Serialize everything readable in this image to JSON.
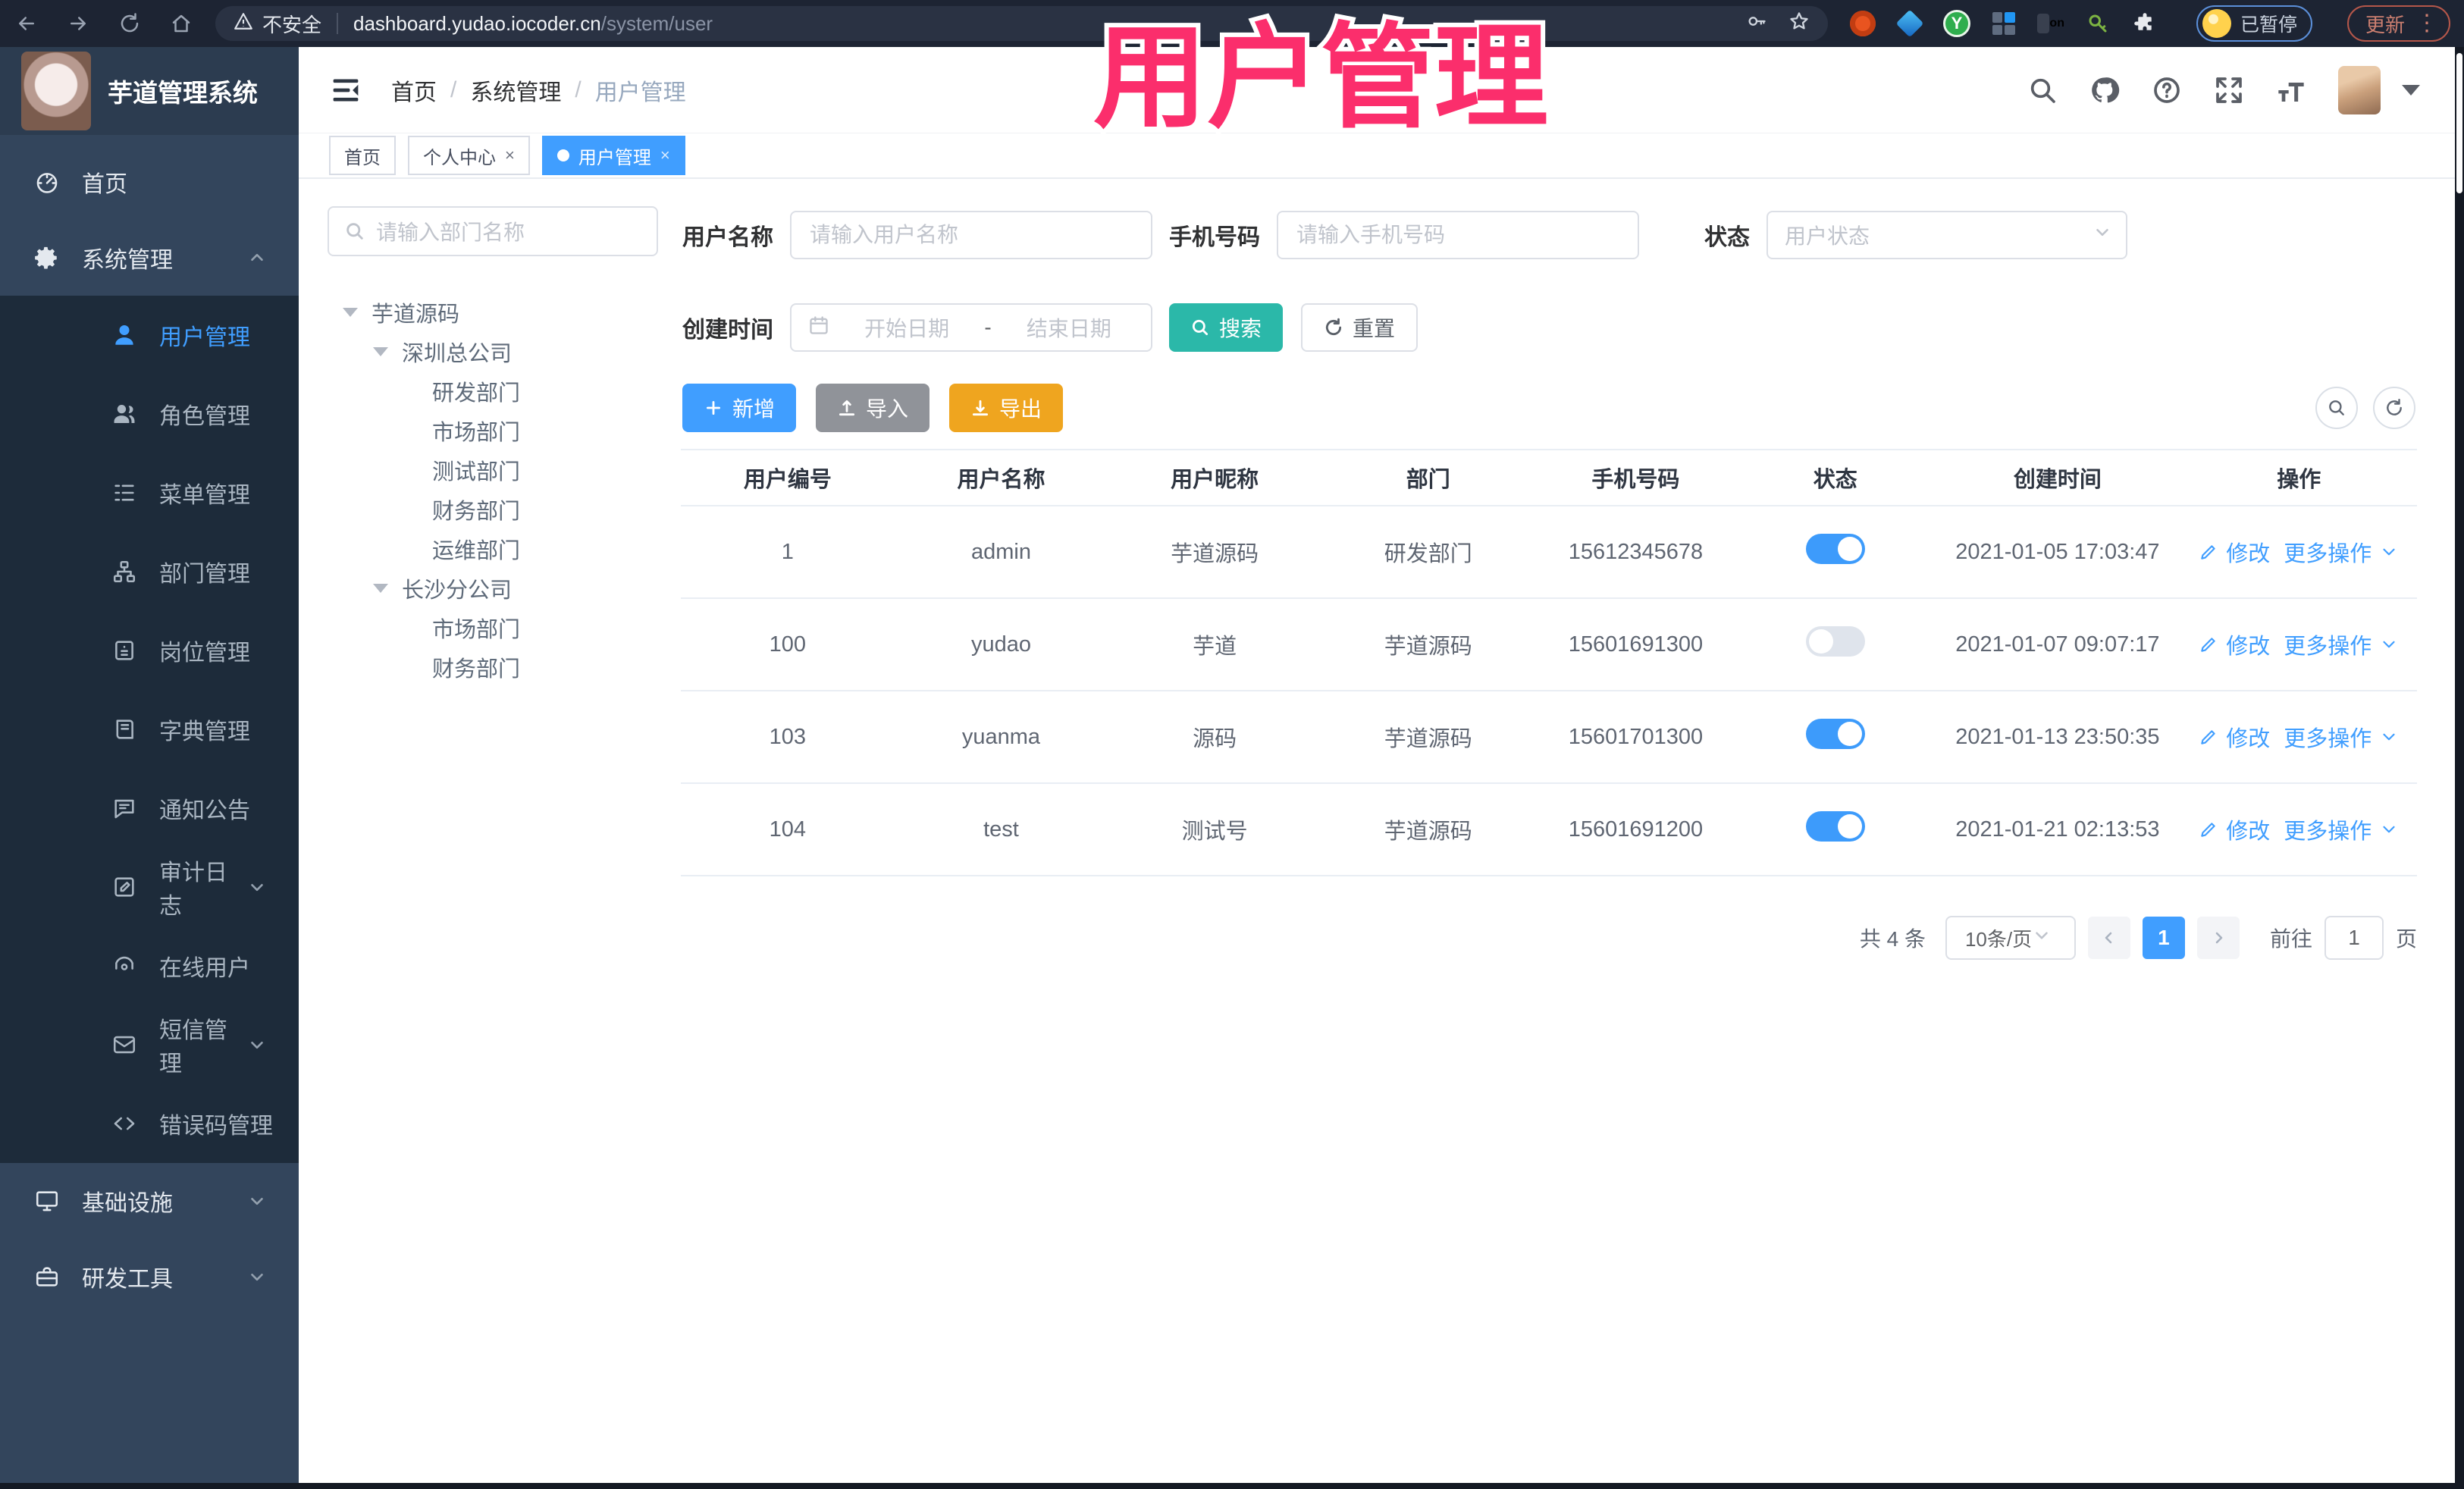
{
  "browser": {
    "url_warning": "不安全",
    "url_host": "dashboard.yudao.iocoder.cn",
    "url_path": "/system/user",
    "paused_badge": "已暂停",
    "update_button": "更新",
    "ext_on_badge": "on",
    "ext_y_letter": "Y"
  },
  "app": {
    "title": "芋道管理系统",
    "overlay_title": "用户管理"
  },
  "breadcrumb": {
    "items": [
      "首页",
      "系统管理",
      "用户管理"
    ]
  },
  "tabs": [
    {
      "label": "首页",
      "closable": false,
      "active": false
    },
    {
      "label": "个人中心",
      "closable": true,
      "active": false
    },
    {
      "label": "用户管理",
      "closable": true,
      "active": true
    }
  ],
  "sidebar": {
    "items": [
      {
        "label": "首页",
        "icon": "dashboard-icon",
        "level": 0
      },
      {
        "label": "系统管理",
        "icon": "gear-icon",
        "level": 0,
        "chevron": "up"
      },
      {
        "label": "用户管理",
        "icon": "user-icon",
        "level": 1,
        "active": true
      },
      {
        "label": "角色管理",
        "icon": "roles-icon",
        "level": 1
      },
      {
        "label": "菜单管理",
        "icon": "menu-tree-icon",
        "level": 1
      },
      {
        "label": "部门管理",
        "icon": "org-icon",
        "level": 1
      },
      {
        "label": "岗位管理",
        "icon": "post-icon",
        "level": 1
      },
      {
        "label": "字典管理",
        "icon": "dict-icon",
        "level": 1
      },
      {
        "label": "通知公告",
        "icon": "notice-icon",
        "level": 1
      },
      {
        "label": "审计日志",
        "icon": "log-icon",
        "level": 1,
        "chevron": "down"
      },
      {
        "label": "在线用户",
        "icon": "online-icon",
        "level": 1
      },
      {
        "label": "短信管理",
        "icon": "sms-icon",
        "level": 1,
        "chevron": "down"
      },
      {
        "label": "错误码管理",
        "icon": "code-icon",
        "level": 1
      },
      {
        "label": "基础设施",
        "icon": "infra-icon",
        "level": 0,
        "chevron": "down"
      },
      {
        "label": "研发工具",
        "icon": "tools-icon",
        "level": 0,
        "chevron": "down"
      }
    ]
  },
  "dept_tree": {
    "search_placeholder": "请输入部门名称",
    "nodes": [
      {
        "label": "芋道源码",
        "depth": 0,
        "caret": true
      },
      {
        "label": "深圳总公司",
        "depth": 1,
        "caret": true
      },
      {
        "label": "研发部门",
        "depth": 2
      },
      {
        "label": "市场部门",
        "depth": 2
      },
      {
        "label": "测试部门",
        "depth": 2
      },
      {
        "label": "财务部门",
        "depth": 2
      },
      {
        "label": "运维部门",
        "depth": 2
      },
      {
        "label": "长沙分公司",
        "depth": 1,
        "caret": true
      },
      {
        "label": "市场部门",
        "depth": 2
      },
      {
        "label": "财务部门",
        "depth": 2
      }
    ]
  },
  "filters": {
    "username_label": "用户名称",
    "username_placeholder": "请输入用户名称",
    "mobile_label": "手机号码",
    "mobile_placeholder": "请输入手机号码",
    "status_label": "状态",
    "status_placeholder": "用户状态",
    "created_label": "创建时间",
    "date_start_placeholder": "开始日期",
    "date_separator": "-",
    "date_end_placeholder": "结束日期",
    "search_button": "搜索",
    "reset_button": "重置"
  },
  "toolbar": {
    "add_button": "新增",
    "import_button": "导入",
    "export_button": "导出"
  },
  "table": {
    "headers": [
      "用户编号",
      "用户名称",
      "用户昵称",
      "部门",
      "手机号码",
      "状态",
      "创建时间",
      "操作"
    ],
    "edit_label": "修改",
    "more_label": "更多操作",
    "rows": [
      {
        "id": "1",
        "username": "admin",
        "nickname": "芋道源码",
        "dept": "研发部门",
        "mobile": "15612345678",
        "status_on": true,
        "created": "2021-01-05 17:03:47"
      },
      {
        "id": "100",
        "username": "yudao",
        "nickname": "芋道",
        "dept": "芋道源码",
        "mobile": "15601691300",
        "status_on": false,
        "created": "2021-01-07 09:07:17"
      },
      {
        "id": "103",
        "username": "yuanma",
        "nickname": "源码",
        "dept": "芋道源码",
        "mobile": "15601701300",
        "status_on": true,
        "created": "2021-01-13 23:50:35"
      },
      {
        "id": "104",
        "username": "test",
        "nickname": "测试号",
        "dept": "芋道源码",
        "mobile": "15601691200",
        "status_on": true,
        "created": "2021-01-21 02:13:53"
      }
    ]
  },
  "pagination": {
    "total": "共 4 条",
    "page_size": "10条/页",
    "current_page": "1",
    "goto_label": "前往",
    "goto_value": "1",
    "page_unit": "页"
  }
}
